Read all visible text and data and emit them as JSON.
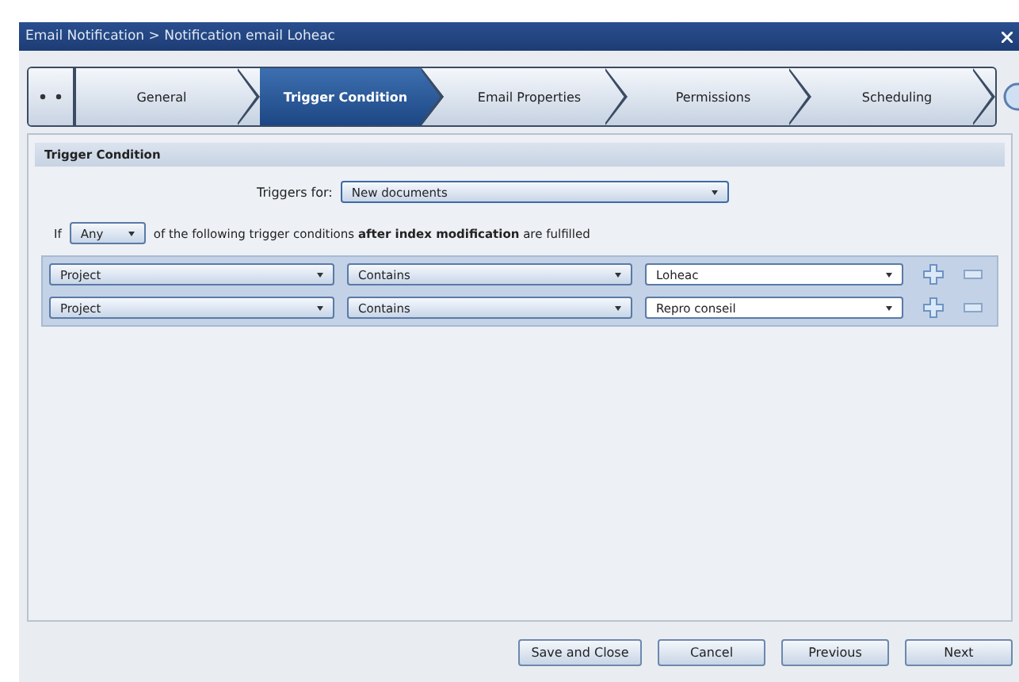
{
  "window": {
    "title": "Email Notification > Notification email Loheac"
  },
  "tabs": [
    {
      "label": "General",
      "selected": false
    },
    {
      "label": "Trigger Condition",
      "selected": true
    },
    {
      "label": "Email Properties",
      "selected": false
    },
    {
      "label": "Permissions",
      "selected": false
    },
    {
      "label": "Scheduling",
      "selected": false
    }
  ],
  "section": {
    "title": "Trigger Condition"
  },
  "triggers_for": {
    "label": "Triggers for:",
    "value": "New documents"
  },
  "match": {
    "prefix": "If",
    "value": "Any",
    "text": "of the following trigger conditions **after index modification** are fulfilled"
  },
  "conditions": [
    {
      "field": "Project",
      "operator": "Contains",
      "value": "Loheac"
    },
    {
      "field": "Project",
      "operator": "Contains",
      "value": "Repro conseil"
    }
  ],
  "buttons": [
    "Save and Close",
    "Cancel",
    "Previous",
    "Next"
  ]
}
